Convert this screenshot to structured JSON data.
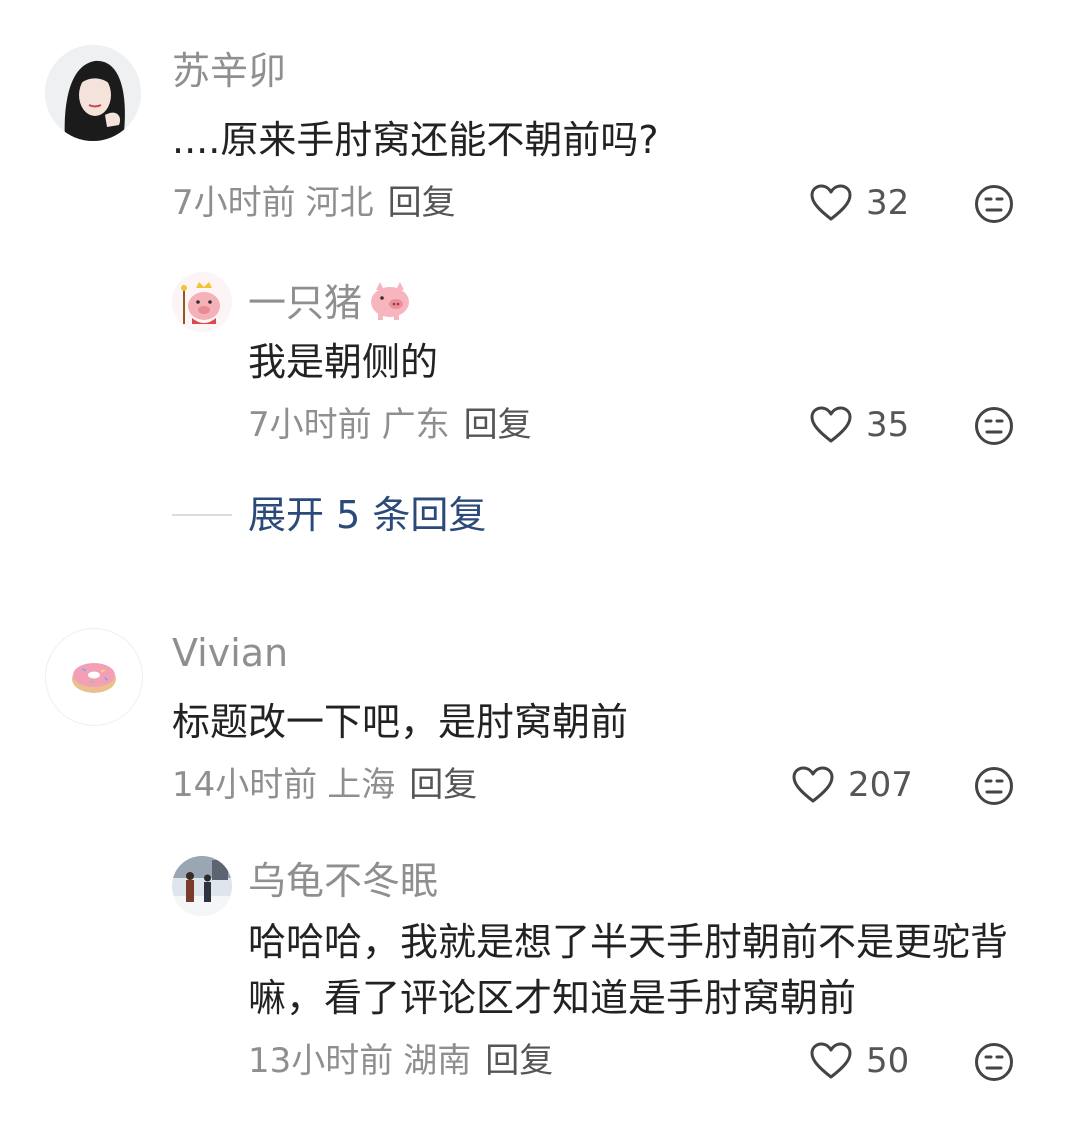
{
  "comments": [
    {
      "user": "苏辛卯",
      "text": "....原来手肘窝还能不朝前吗?",
      "time": "7小时前",
      "location": "河北",
      "reply_label": "回复",
      "likes": "32",
      "avatar_icon": "girl-portrait-avatar"
    },
    {
      "user": "一只猪",
      "text": "我是朝侧的",
      "time": "7小时前",
      "location": "广东",
      "reply_label": "回复",
      "likes": "35",
      "avatar_icon": "pig-king-avatar",
      "name_emoji": "pig-emoji"
    },
    {
      "user": "Vivian",
      "text": "标题改一下吧，是肘窝朝前",
      "time": "14小时前",
      "location": "上海",
      "reply_label": "回复",
      "likes": "207",
      "avatar_icon": "donut-avatar"
    },
    {
      "user": "乌龟不冬眠",
      "text": "哈哈哈，我就是想了半天手肘朝前不是更驼背嘛，看了评论区才知道是手肘窝朝前",
      "time": "13小时前",
      "location": "湖南",
      "reply_label": "回复",
      "likes": "50",
      "avatar_icon": "snow-street-avatar"
    }
  ],
  "expand_replies": "展开 5 条回复",
  "colors": {
    "meta": "#8f8f8f",
    "link": "#2b4a7a",
    "text": "#222222"
  }
}
